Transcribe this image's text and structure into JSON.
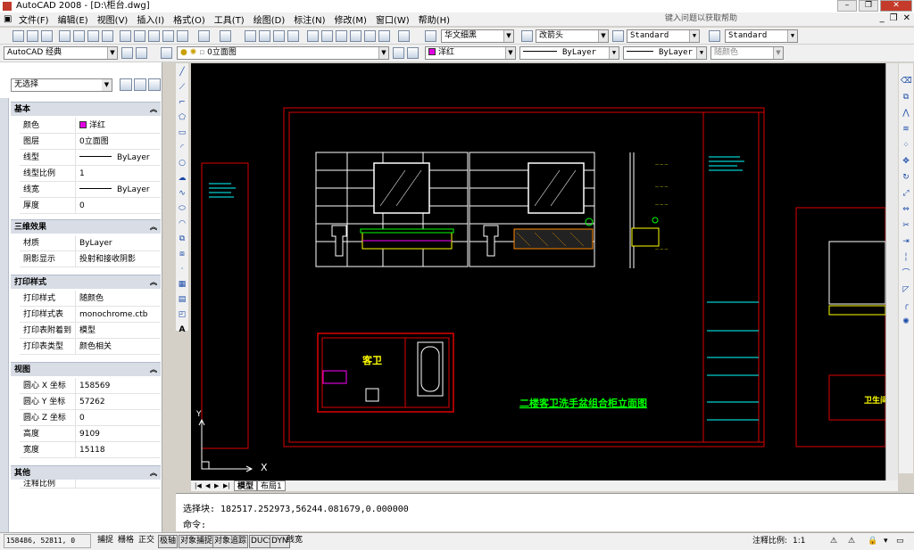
{
  "window": {
    "title": "AutoCAD 2008 - [D:\\柜台.dwg]"
  },
  "menu": {
    "items": [
      "文件(F)",
      "编辑(E)",
      "视图(V)",
      "插入(I)",
      "格式(O)",
      "工具(T)",
      "绘图(D)",
      "标注(N)",
      "修改(M)",
      "窗口(W)",
      "帮助(H)"
    ],
    "help_placeholder": "键入问题以获取帮助"
  },
  "toolbar": {
    "workspace": "AutoCAD 经典",
    "text_font": "华文细黑",
    "dim_style": "改箭头",
    "text_style": "Standard",
    "table_style": "Standard",
    "layer": "0立面图",
    "color": "洋红",
    "linetype": "ByLayer",
    "lineweight": "ByLayer",
    "plotstyle": "随颜色"
  },
  "properties": {
    "selection": "无选择",
    "sections": {
      "basic": "基本",
      "threed": "三维效果",
      "plot": "打印样式",
      "view": "视图",
      "misc": "其他"
    },
    "basic_rows": [
      {
        "k": "颜色",
        "v": "洋红"
      },
      {
        "k": "图层",
        "v": "0立面图"
      },
      {
        "k": "线型",
        "v": "ByLayer"
      },
      {
        "k": "线型比例",
        "v": "1"
      },
      {
        "k": "线宽",
        "v": "ByLayer"
      },
      {
        "k": "厚度",
        "v": "0"
      }
    ],
    "threed_rows": [
      {
        "k": "材质",
        "v": "ByLayer"
      },
      {
        "k": "阴影显示",
        "v": "投射和接收阴影"
      }
    ],
    "plot_rows": [
      {
        "k": "打印样式",
        "v": "随颜色"
      },
      {
        "k": "打印样式表",
        "v": "monochrome.ctb"
      },
      {
        "k": "打印表附着到",
        "v": "模型"
      },
      {
        "k": "打印表类型",
        "v": "颜色相关"
      }
    ],
    "view_rows": [
      {
        "k": "圆心 X 坐标",
        "v": "158569"
      },
      {
        "k": "圆心 Y 坐标",
        "v": "57262"
      },
      {
        "k": "圆心 Z 坐标",
        "v": "0"
      },
      {
        "k": "高度",
        "v": "9109"
      },
      {
        "k": "宽度",
        "v": "15118"
      }
    ],
    "misc_first": "注释比例"
  },
  "drawing": {
    "room_label": "客卫",
    "room_label2": "卫生间",
    "title": "二楼客卫洗手盆组合柜立面图",
    "axis_x": "X",
    "axis_y": "Y"
  },
  "tabs": {
    "model": "模型",
    "layout1": "布局1"
  },
  "command": {
    "line1": "选择块: 182517.252973,56244.081679,0.000000",
    "line2": "命令:"
  },
  "status": {
    "coords": "158486, 52811, 0",
    "buttons": [
      "捕捉",
      "栅格",
      "正交",
      "极轴",
      "对象捕捉",
      "对象追踪",
      "DUCS",
      "DYN",
      "线宽"
    ],
    "annotation_scale_label": "注释比例:",
    "annotation_scale": "1:1"
  }
}
